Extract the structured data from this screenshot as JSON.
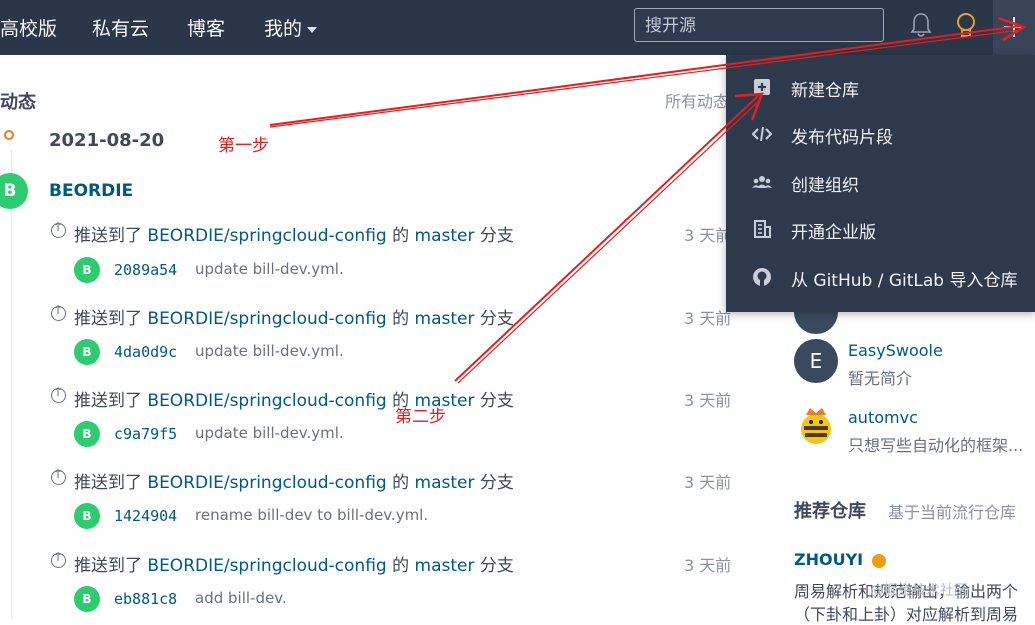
{
  "nav": {
    "items": [
      "高校版",
      "私有云",
      "博客",
      "我的"
    ],
    "search_placeholder": "搜开源"
  },
  "activity": {
    "title": "动态",
    "all_link": "所有动态",
    "date": "2021-08-20",
    "user_initial": "B",
    "username": "BEORDIE",
    "events": [
      {
        "prefix": "推送到了 ",
        "repo": "BEORDIE/springcloud-config",
        "mid": " 的 ",
        "branch": "master",
        "suffix": " 分支",
        "time": "3 天前",
        "avatar": "B",
        "sha": "2089a54",
        "message": "update bill-dev.yml."
      },
      {
        "prefix": "推送到了 ",
        "repo": "BEORDIE/springcloud-config",
        "mid": " 的 ",
        "branch": "master",
        "suffix": " 分支",
        "time": "3 天前",
        "avatar": "B",
        "sha": "4da0d9c",
        "message": "update bill-dev.yml."
      },
      {
        "prefix": "推送到了 ",
        "repo": "BEORDIE/springcloud-config",
        "mid": " 的 ",
        "branch": "master",
        "suffix": " 分支",
        "time": "3 天前",
        "avatar": "B",
        "sha": "c9a79f5",
        "message": "update bill-dev.yml."
      },
      {
        "prefix": "推送到了 ",
        "repo": "BEORDIE/springcloud-config",
        "mid": " 的 ",
        "branch": "master",
        "suffix": " 分支",
        "time": "3 天前",
        "avatar": "B",
        "sha": "1424904",
        "message": "rename bill-dev to bill-dev.yml."
      },
      {
        "prefix": "推送到了 ",
        "repo": "BEORDIE/springcloud-config",
        "mid": " 的 ",
        "branch": "master",
        "suffix": " 分支",
        "time": "3 天前",
        "avatar": "B",
        "sha": "eb881c8",
        "message": "add bill-dev."
      }
    ]
  },
  "sidebar": {
    "users": [
      {
        "initial": "E",
        "name": "EasySwoole",
        "desc": "暂无简介"
      },
      {
        "name": "automvc",
        "desc": "只想写些自动化的框架..."
      }
    ],
    "recommend_title": "推荐仓库",
    "recommend_sub": "基于当前流行仓库",
    "repo_name": "ZHOUYI",
    "repo_desc_1": "周易解析和规范输出，输出两个",
    "repo_desc_2": "（下卦和上卦）对应解析到周易",
    "watermark": "@掘金技术社区"
  },
  "dropdown": {
    "items": [
      {
        "icon": "plus-square-icon",
        "label": "新建仓库"
      },
      {
        "icon": "code-icon",
        "label": "发布代码片段"
      },
      {
        "icon": "group-icon",
        "label": "创建组织"
      },
      {
        "icon": "building-icon",
        "label": "开通企业版"
      },
      {
        "icon": "github-icon",
        "label": "从 GitHub / GitLab 导入仓库"
      }
    ]
  },
  "annotations": {
    "step1": "第一步",
    "step2": "第二步"
  },
  "colors": {
    "nav_bg": "#2c3649",
    "link": "#005980",
    "avatar_green": "#2ecc71",
    "annotation_red": "#e02020"
  }
}
